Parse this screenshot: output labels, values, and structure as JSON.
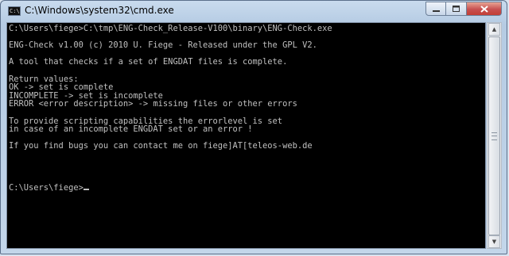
{
  "window": {
    "title": "C:\\Windows\\system32\\cmd.exe",
    "icon_text": "C:\\"
  },
  "controls": {
    "minimize_icon": "minimize-icon",
    "maximize_icon": "maximize-icon",
    "close_icon": "close-icon"
  },
  "console": {
    "lines": [
      "C:\\Users\\fiege>C:\\tmp\\ENG-Check_Release-V100\\binary\\ENG-Check.exe",
      "",
      "ENG-Check v1.00 (c) 2010 U. Fiege - Released under the GPL V2.",
      "",
      "A tool that checks if a set of ENGDAT files is complete.",
      "",
      "Return values:",
      "OK -> set is complete",
      "INCOMPLETE -> set is incomplete",
      "ERROR <error description> -> missing files or other errors",
      "",
      "To provide scripting capabilities the errorlevel is set",
      "in case of an incomplete ENGDAT set or an error !",
      "",
      "If you find bugs you can contact me on fiege]AT[teleos-web.de",
      "",
      "",
      "",
      ""
    ],
    "prompt": "C:\\Users\\fiege>"
  },
  "colors": {
    "console_bg": "#000000",
    "console_fg": "#c0c0c0",
    "close_button": "#c75050"
  }
}
